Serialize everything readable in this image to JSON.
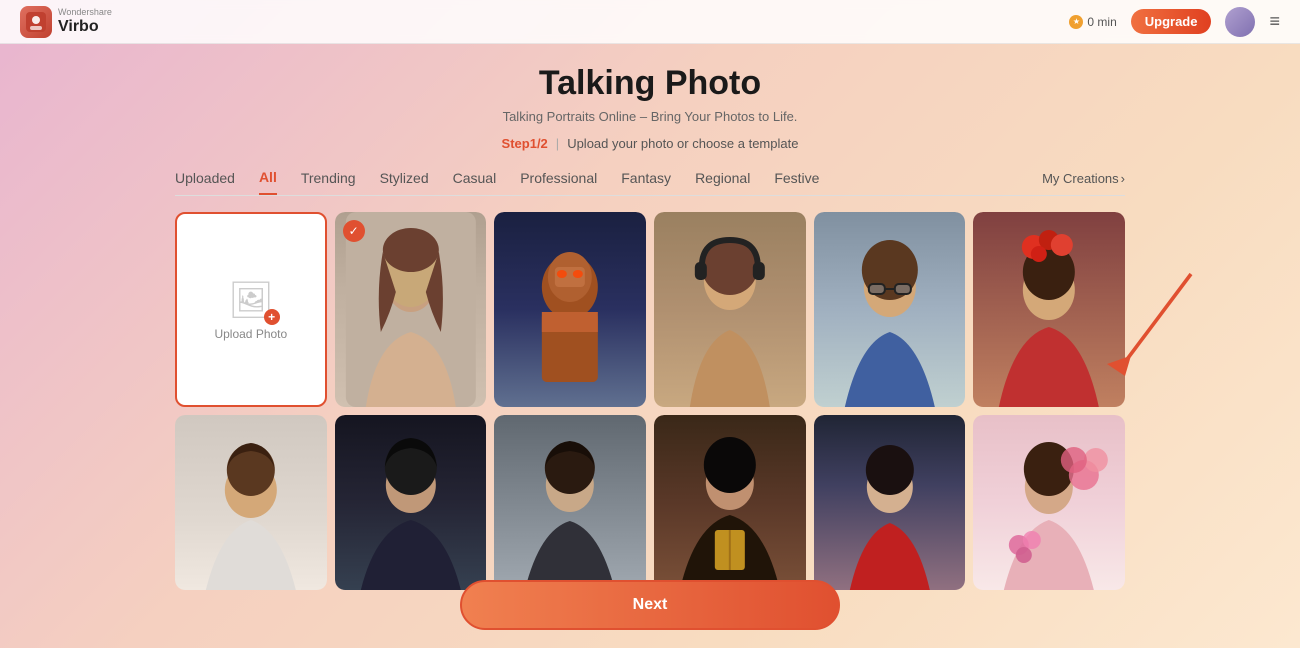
{
  "header": {
    "logo_brand": "Wondershare",
    "logo_app": "Virbo",
    "min_label": "0 min",
    "upgrade_label": "Upgrade",
    "menu_icon": "≡"
  },
  "page": {
    "title": "Talking Photo",
    "subtitle": "Talking Portraits Online – Bring Your Photos to Life.",
    "step_label": "Step1/2",
    "step_divider": "|",
    "step_desc": "Upload your photo or choose a template"
  },
  "tabs": {
    "items": [
      {
        "id": "uploaded",
        "label": "Uploaded",
        "active": false
      },
      {
        "id": "all",
        "label": "All",
        "active": true
      },
      {
        "id": "trending",
        "label": "Trending",
        "active": false
      },
      {
        "id": "stylized",
        "label": "Stylized",
        "active": false
      },
      {
        "id": "casual",
        "label": "Casual",
        "active": false
      },
      {
        "id": "professional",
        "label": "Professional",
        "active": false
      },
      {
        "id": "fantasy",
        "label": "Fantasy",
        "active": false
      },
      {
        "id": "regional",
        "label": "Regional",
        "active": false
      },
      {
        "id": "festive",
        "label": "Festive",
        "active": false
      }
    ],
    "my_creations": "My Creations"
  },
  "upload_card": {
    "label": "Upload Photo"
  },
  "next_button": {
    "label": "Next"
  }
}
